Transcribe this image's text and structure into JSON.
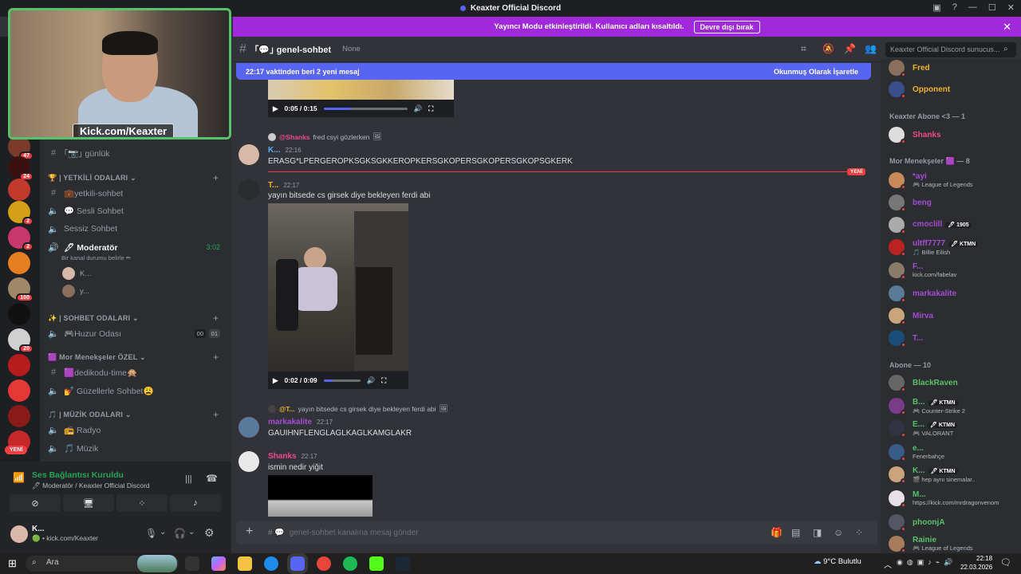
{
  "window": {
    "title": "Keaxter Official Discord"
  },
  "banner": {
    "text": "Yayıncı Modu etkinleştirildi. Kullanıcı adları kısaltıldı.",
    "button": "Devre dışı bırak"
  },
  "servers": [
    {
      "badge": "47",
      "color": "#7a3b2a"
    },
    {
      "badge": "24",
      "color": "#3a1010"
    },
    {
      "badge": "",
      "color": "#c0392b"
    },
    {
      "badge": "2",
      "color": "#d4a017"
    },
    {
      "badge": "2",
      "color": "#c9386b"
    },
    {
      "badge": "",
      "color": "#e67e22"
    },
    {
      "badge": "100",
      "color": "#a0876a"
    },
    {
      "badge": "",
      "color": "#111111"
    },
    {
      "badge": "20",
      "color": "#d0d0d0"
    },
    {
      "badge": "",
      "color": "#b71c1c"
    },
    {
      "badge": "",
      "color": "#e53935"
    },
    {
      "badge": "",
      "color": "#8b1a1a"
    },
    {
      "badge": "",
      "color": "#c62828"
    }
  ],
  "rail_new": "YENİ",
  "webcam": {
    "label": "Kick.com/Keaxter"
  },
  "channels": {
    "gunluk": "｢📷｣ günlük",
    "cat_yetkili": "🏆 | YETKİLİ ODALARI",
    "yetkili_sohbet": "💼yetkili-sohbet",
    "sesli_sohbet": "💬 Sesli Sohbet",
    "sessiz_sohbet": "Sessiz Sohbet",
    "moderator": "🖊 Moderatör",
    "moderator_time": "3:02",
    "moderator_status": "Bir kanal durumu belirle ✏",
    "voice_users": [
      "K...",
      "y..."
    ],
    "cat_sohbet": "✨ | SOHBET ODALARI",
    "huzur": "🎮Huzur Odası",
    "huzur_counts": [
      "00",
      "01"
    ],
    "cat_mor": "🟪 Mor Menekşeler ÖZEL",
    "dedikodu": "🟪dedikodu-time🙊",
    "guzellerle": "💅 Güzellerle Sohbet😩",
    "cat_muzik": "🎵 | MÜZİK ODALARI",
    "radyo": "📻 Radyo",
    "muzik": "🎵 Müzik"
  },
  "voice": {
    "title": "Ses Bağlantısı Kuruldu",
    "sub": "🖊 Moderatör / Keaxter Official Discord",
    "user_name": "K...",
    "user_status": "🟢 • kick.com/Keaxter"
  },
  "chat": {
    "channel": "｢💬｣ genel-sohbet",
    "topic": "None",
    "search": "Keaxter Official Discord sunucus...",
    "newbar_left": "22:17 vaktinden beri 2 yeni mesaj",
    "newbar_right": "Okunmuş Olarak İşaretle",
    "video1_time": "0:05 / 0:15",
    "video1_progress": 0.33,
    "msg1_reply_user": "@Shanks",
    "msg1_reply_text": "fred csyi gözlerken",
    "msg1_user": "K...",
    "msg1_time": "22:16",
    "msg1_text": "ERASG*LPERGEROPKSGKSGKKEROPKERSGKOPERSGKOPERSGKOPSGKERK",
    "new_tag": "YENİ",
    "msg2_user": "T...",
    "msg2_time": "22:17",
    "msg2_text": "yayın bitsede cs girsek diye  bekleyen ferdi abi",
    "video2_time": "0:02 / 0:09",
    "video2_progress": 0.25,
    "msg3_reply_user": "@T...",
    "msg3_reply_text": "yayın bitsede cs girsek diye  bekleyen ferdi abi",
    "msg3_user": "markakalite",
    "msg3_time": "22:17",
    "msg3_text": "GAUIHNFLENGLAGLKAGLKAMGLAKR",
    "msg4_user": "Shanks",
    "msg4_time": "22:17",
    "msg4_text": "ismin nedir yiğit",
    "composer": "genel-sohbet kanalına mesaj gönder"
  },
  "members": {
    "top": [
      {
        "name": "Fred",
        "color": "#f0b232",
        "act": "",
        "av": "#8a6f5c"
      },
      {
        "name": "Opponent",
        "color": "#f0b232",
        "act": "",
        "av": "#3a4e8c"
      }
    ],
    "group1": "Keaxter Abone <3 — 1",
    "g1": [
      {
        "name": "Shanks",
        "color": "#f04a8b",
        "act": "",
        "tag": "",
        "av": "#ddd"
      }
    ],
    "group2": "Mor Menekşeler 🟪 — 8",
    "g2": [
      {
        "name": "*ayi",
        "color": "#a34dd4",
        "act": "🎮 League of Legends",
        "tag": "",
        "av": "#c98a5a"
      },
      {
        "name": "beng",
        "color": "#a34dd4",
        "act": "",
        "tag": "",
        "av": "#777"
      },
      {
        "name": "cmoclill",
        "color": "#a34dd4",
        "act": "",
        "tag": "🖊 1905",
        "av": "#aaa"
      },
      {
        "name": "ultff7777",
        "color": "#a34dd4",
        "act": "🎵 Billie Eilish",
        "tag": "🖊 KTMN",
        "av": "#b22"
      },
      {
        "name": "F...",
        "color": "#a34dd4",
        "act": "kick.com/fabelav",
        "tag": "",
        "av": "#8a7a6a"
      },
      {
        "name": "markakalite",
        "color": "#a34dd4",
        "act": "",
        "tag": "",
        "av": "#5a7a9a"
      },
      {
        "name": "Mirva",
        "color": "#a34dd4",
        "act": "",
        "tag": "",
        "av": "#c9a47c"
      },
      {
        "name": "T...",
        "color": "#a34dd4",
        "act": "",
        "tag": "",
        "av": "#1a4d7a"
      }
    ],
    "group3": "Abone — 10",
    "g3": [
      {
        "name": "BlackRaven",
        "color": "#57c26a",
        "act": "",
        "tag": "",
        "av": "#666"
      },
      {
        "name": "B...",
        "color": "#57c26a",
        "act": "🎮 Counter-Strike 2",
        "tag": "🖊 KTMN",
        "av": "#7a3b8a"
      },
      {
        "name": "E...",
        "color": "#57c26a",
        "act": "🎮 VALORANT",
        "tag": "🖊 KTMN",
        "av": "#334"
      },
      {
        "name": "e...",
        "color": "#57c26a",
        "act": "Fenerbahçe",
        "tag": "",
        "av": "#3a5a8a"
      },
      {
        "name": "K...",
        "color": "#57c26a",
        "act": "🎬 hep aynı sinemalar..",
        "tag": "🖊 KTMN",
        "av": "#c9a47c"
      },
      {
        "name": "M...",
        "color": "#57c26a",
        "act": "https://kick.com/mrdragonvenom",
        "tag": "",
        "av": "#e8e0e8"
      },
      {
        "name": "phoonjA",
        "color": "#57c26a",
        "act": "",
        "tag": "",
        "av": "#556"
      },
      {
        "name": "Rainie",
        "color": "#57c26a",
        "act": "🎮 League of Legends",
        "tag": "",
        "av": "#a67c5a"
      }
    ]
  },
  "taskbar": {
    "search": "Ara",
    "weather": "9°C  Bulutlu",
    "time": "22:18",
    "date": "22.03.2026"
  }
}
